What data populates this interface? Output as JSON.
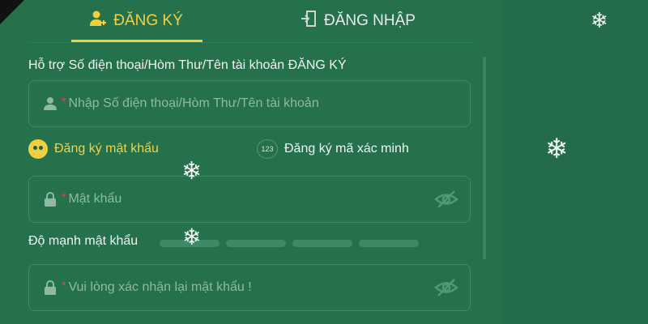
{
  "tabs": {
    "register": "ĐĂNG KÝ",
    "login": "ĐĂNG NHẬP"
  },
  "form": {
    "support_label": "Hỗ trợ Số điện thoại/Hòm Thư/Tên tài khoản ĐĂNG KÝ",
    "account_placeholder": "Nhập Số điện thoại/Hòm Thư/Tên tài khoản",
    "required_mark": "*",
    "options": {
      "password": "Đăng ký mật khẩu",
      "code_badge": "123",
      "code": "Đăng ký mã xác minh"
    },
    "password_placeholder": "Mật khẩu",
    "strength_label": "Độ mạnh mật khẩu",
    "strength_level": 0,
    "strength_segments": 4,
    "confirm_placeholder": "Vui lòng xác nhận lại mật khẩu !"
  },
  "icons": {
    "register_tab": "user-plus-icon",
    "login_tab": "door-enter-icon",
    "account_field": "user-icon",
    "password_field": "lock-icon",
    "password_toggle": "eye-off-icon",
    "decor": "snowflake-icon"
  },
  "colors": {
    "accent": "#f2cf3f",
    "panel": "#24714c",
    "required": "#e04747"
  }
}
